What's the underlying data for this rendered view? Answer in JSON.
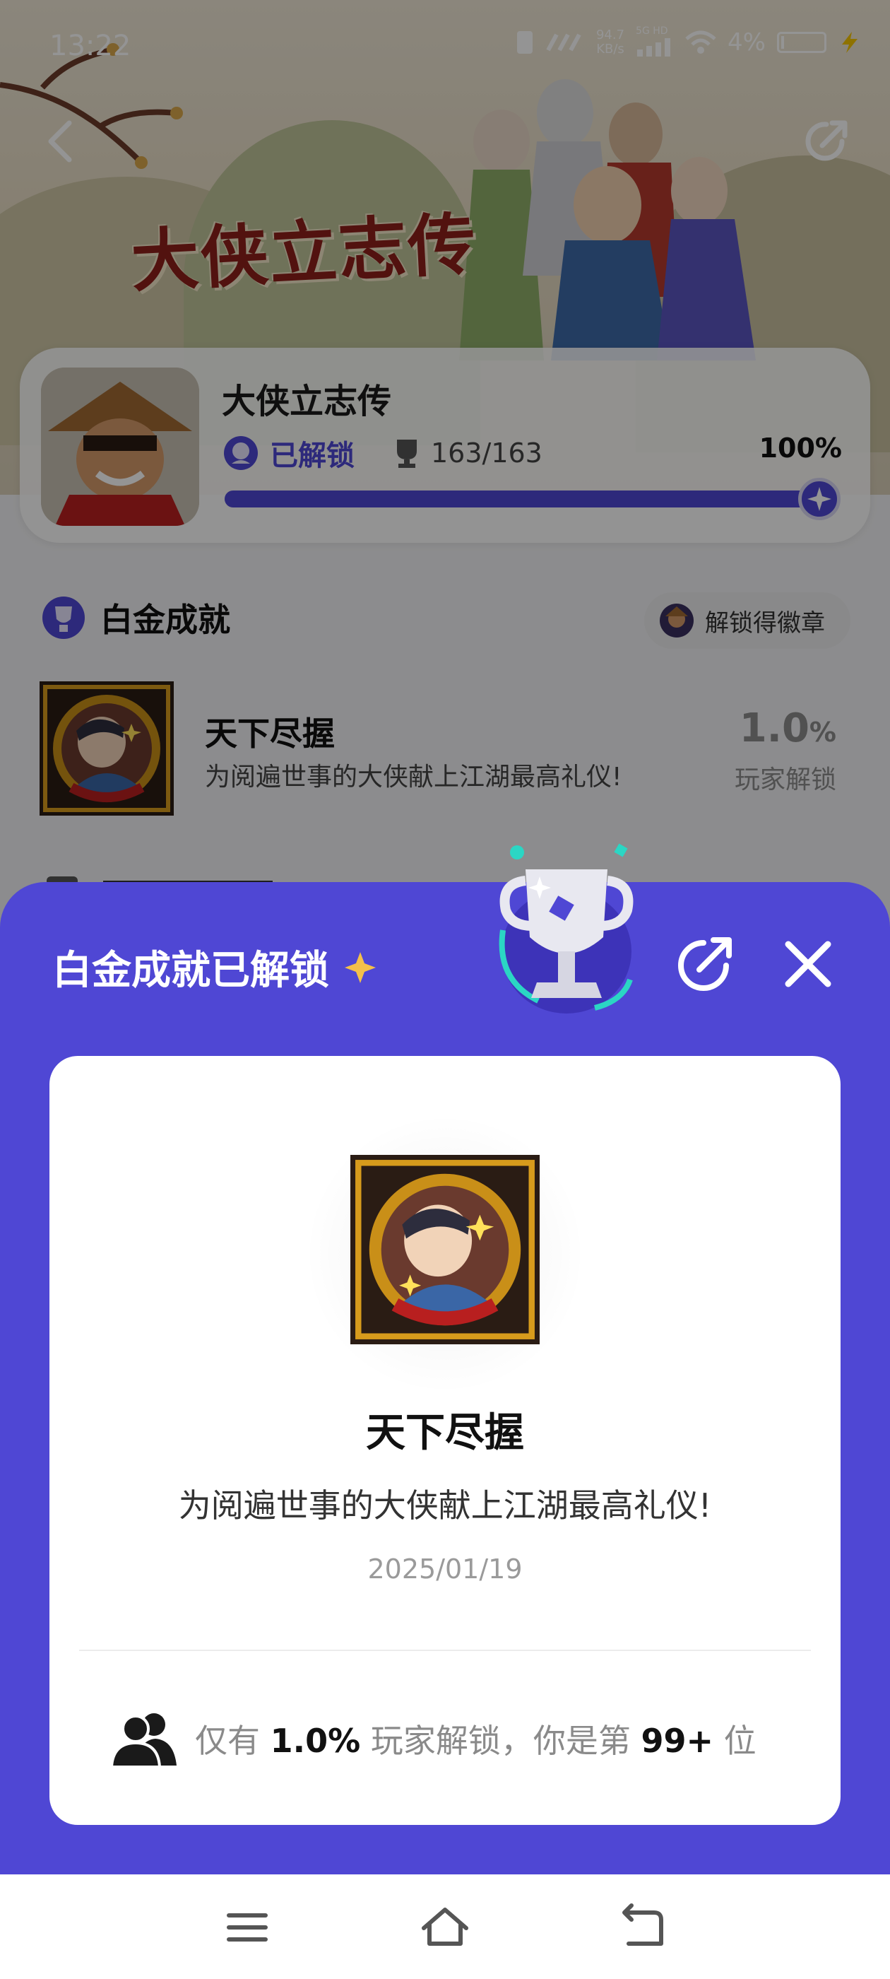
{
  "status_bar": {
    "time": "13:22",
    "network_speed_value": "94.7",
    "network_speed_unit": "KB/s",
    "signal_label": "5G HD",
    "battery_percent": "4%"
  },
  "hero": {
    "logo_text": "大侠立志传"
  },
  "game": {
    "name": "大侠立志传",
    "unlock_status": "已解锁",
    "trophy_count": "163/163",
    "percent_text": "100%",
    "progress_fraction": 1.0
  },
  "platinum_section": {
    "title": "白金成就",
    "badge_button": "解锁得徽章",
    "achievement": {
      "name": "天下尽握",
      "description": "为阅遍世事的大侠献上江湖最高礼仪!",
      "rate_value": "1.0",
      "rate_unit": "%",
      "rate_label": "玩家解锁"
    }
  },
  "sheet": {
    "title": "白金成就已解锁",
    "achievement_name": "天下尽握",
    "achievement_description": "为阅遍世事的大侠献上江湖最高礼仪!",
    "date": "2025/01/19",
    "stat_prefix": "仅有",
    "stat_percent": "1.0%",
    "stat_middle": "玩家解锁，你是第",
    "stat_rank": "99+",
    "stat_suffix": "位"
  },
  "colors": {
    "accent": "#4f47d4",
    "progress_track": "#d8d6f3",
    "star": "#f4c04a"
  },
  "icons": [
    "back-arrow-icon",
    "share-icon",
    "unlocked-icon",
    "trophy-icon",
    "platinum-icon",
    "badge-avatar-icon",
    "star-icon",
    "close-icon",
    "users-icon",
    "menu-icon",
    "home-icon",
    "return-icon"
  ]
}
